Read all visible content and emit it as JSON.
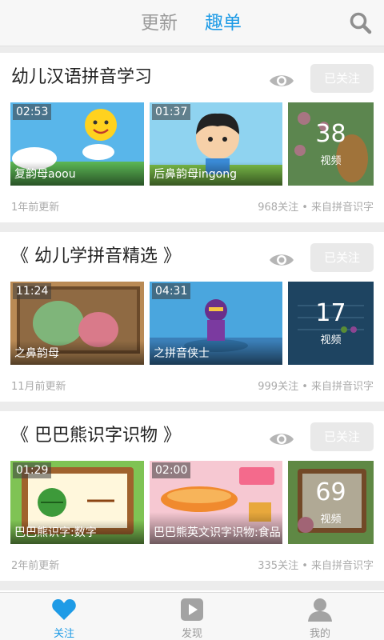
{
  "header": {
    "tabs": [
      {
        "label": "更新",
        "active": false
      },
      {
        "label": "趣单",
        "active": true
      }
    ],
    "accent_color": "#1e9be6"
  },
  "lists": [
    {
      "title": "幼儿汉语拼音学习",
      "follow_label": "已关注",
      "videos": [
        {
          "duration": "02:53",
          "caption": "复韵母aoou"
        },
        {
          "duration": "01:37",
          "caption": "后鼻韵母ingong"
        }
      ],
      "more_count": "38",
      "more_unit": "视频",
      "updated": "1年前更新",
      "stats": "968关注 • 来自拼音识字"
    },
    {
      "title": "《 幼儿学拼音精选 》",
      "follow_label": "已关注",
      "videos": [
        {
          "duration": "11:24",
          "caption": "之鼻韵母"
        },
        {
          "duration": "04:31",
          "caption": "之拼音侠士"
        }
      ],
      "more_count": "17",
      "more_unit": "视频",
      "updated": "11月前更新",
      "stats": "999关注 • 来自拼音识字"
    },
    {
      "title": "《 巴巴熊识字识物 》",
      "follow_label": "已关注",
      "videos": [
        {
          "duration": "01:29",
          "caption": "巴巴熊识字:数字"
        },
        {
          "duration": "02:00",
          "caption": "巴巴熊英文识字识物:食品"
        }
      ],
      "more_count": "69",
      "more_unit": "视频",
      "updated": "2年前更新",
      "stats": "335关注 • 来自拼音识字"
    }
  ],
  "nav": [
    {
      "label": "关注",
      "icon": "heart-icon",
      "active": true
    },
    {
      "label": "发现",
      "icon": "play-icon",
      "active": false
    },
    {
      "label": "我的",
      "icon": "person-icon",
      "active": false
    }
  ]
}
